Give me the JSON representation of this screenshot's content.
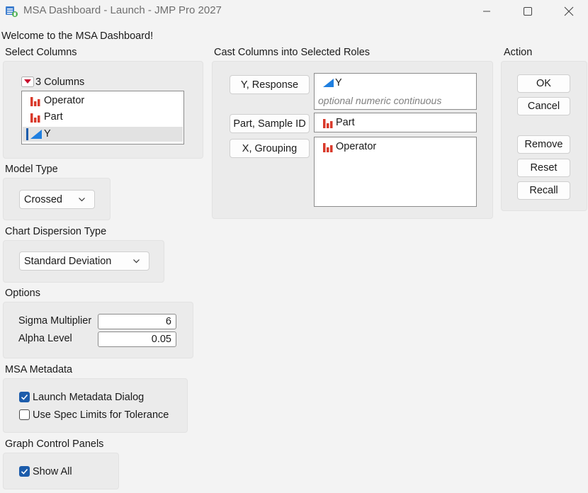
{
  "window": {
    "title": "MSA Dashboard - Launch - JMP Pro 2027",
    "buttons": [
      "minimize-icon",
      "maximize-icon",
      "close-icon"
    ]
  },
  "welcome": "Welcome to the MSA Dashboard!",
  "select_columns": {
    "header": "Select Columns",
    "count_label": "3 Columns",
    "columns": [
      {
        "name": "Operator",
        "icon": "nominal-bar-icon",
        "selected": false
      },
      {
        "name": "Part",
        "icon": "nominal-bar-icon",
        "selected": false
      },
      {
        "name": "Y",
        "icon": "continuous-triangle-icon",
        "selected": true
      }
    ]
  },
  "cast_columns": {
    "header": "Cast Columns into Selected Roles",
    "roles": [
      {
        "button": "Y, Response",
        "value": "Y",
        "hint": "optional numeric continuous",
        "icon": "continuous-triangle-icon"
      },
      {
        "button": "Part, Sample ID",
        "value": "Part",
        "icon": "nominal-bar-icon"
      },
      {
        "button": "X, Grouping",
        "value": "Operator",
        "icon": "nominal-bar-icon"
      }
    ]
  },
  "action": {
    "header": "Action",
    "buttons": [
      "OK",
      "Cancel",
      "Remove",
      "Reset",
      "Recall"
    ]
  },
  "model_type": {
    "header": "Model Type",
    "selected": "Crossed"
  },
  "chart_dispersion": {
    "header": "Chart Dispersion Type",
    "selected": "Standard Deviation"
  },
  "options": {
    "header": "Options",
    "sigma_label": "Sigma Multiplier",
    "sigma_value": "6",
    "alpha_label": "Alpha Level",
    "alpha_value": "0.05"
  },
  "msa_metadata": {
    "header": "MSA Metadata",
    "launch_label": "Launch Metadata Dialog",
    "launch_checked": true,
    "spec_label": "Use Spec Limits for Tolerance",
    "spec_checked": false
  },
  "graph_control": {
    "header": "Graph Control Panels",
    "show_all_label": "Show All",
    "show_all_checked": true
  },
  "colors": {
    "accent": "#1c5cab",
    "nominal_red": "#d93a2b",
    "continuous_blue": "#1f7fe0"
  }
}
